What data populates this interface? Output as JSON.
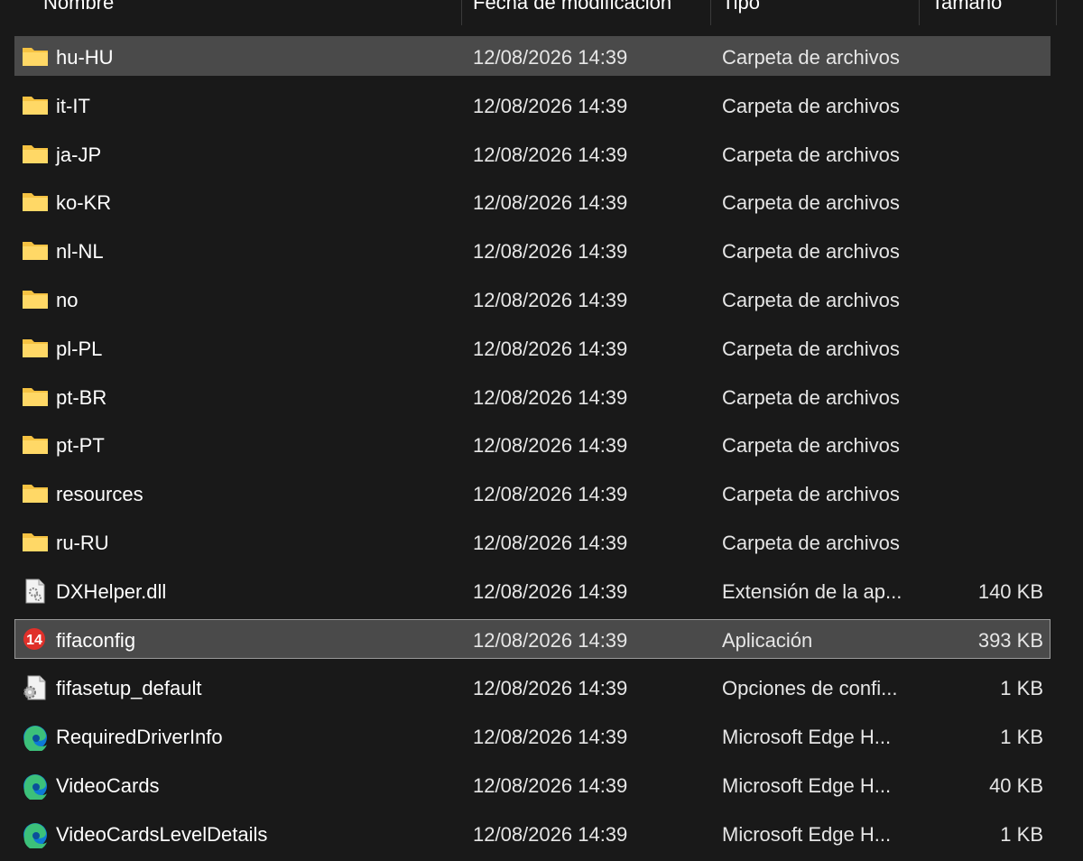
{
  "columns": {
    "name": "Nombre",
    "date": "Fecha de modificación",
    "type": "Tipo",
    "size": "Tamaño"
  },
  "files": [
    {
      "name": "hu-HU",
      "date": "12/08/2026 14:39",
      "type": "Carpeta de archivos",
      "size": "",
      "icon": "folder-icon",
      "state": "selected"
    },
    {
      "name": "it-IT",
      "date": "12/08/2026 14:39",
      "type": "Carpeta de archivos",
      "size": "",
      "icon": "folder-icon",
      "state": ""
    },
    {
      "name": "ja-JP",
      "date": "12/08/2026 14:39",
      "type": "Carpeta de archivos",
      "size": "",
      "icon": "folder-icon",
      "state": ""
    },
    {
      "name": "ko-KR",
      "date": "12/08/2026 14:39",
      "type": "Carpeta de archivos",
      "size": "",
      "icon": "folder-icon",
      "state": ""
    },
    {
      "name": "nl-NL",
      "date": "12/08/2026 14:39",
      "type": "Carpeta de archivos",
      "size": "",
      "icon": "folder-icon",
      "state": ""
    },
    {
      "name": "no",
      "date": "12/08/2026 14:39",
      "type": "Carpeta de archivos",
      "size": "",
      "icon": "folder-icon",
      "state": ""
    },
    {
      "name": "pl-PL",
      "date": "12/08/2026 14:39",
      "type": "Carpeta de archivos",
      "size": "",
      "icon": "folder-icon",
      "state": ""
    },
    {
      "name": "pt-BR",
      "date": "12/08/2026 14:39",
      "type": "Carpeta de archivos",
      "size": "",
      "icon": "folder-icon",
      "state": ""
    },
    {
      "name": "pt-PT",
      "date": "12/08/2026 14:39",
      "type": "Carpeta de archivos",
      "size": "",
      "icon": "folder-icon",
      "state": ""
    },
    {
      "name": "resources",
      "date": "12/08/2026 14:39",
      "type": "Carpeta de archivos",
      "size": "",
      "icon": "folder-icon",
      "state": ""
    },
    {
      "name": "ru-RU",
      "date": "12/08/2026 14:39",
      "type": "Carpeta de archivos",
      "size": "",
      "icon": "folder-icon",
      "state": ""
    },
    {
      "name": "DXHelper.dll",
      "date": "12/08/2026 14:39",
      "type": "Extensión de la ap...",
      "size": "140 KB",
      "icon": "dll-file-icon",
      "state": ""
    },
    {
      "name": "fifaconfig",
      "date": "12/08/2026 14:39",
      "type": "Aplicación",
      "size": "393 KB",
      "icon": "fifa14-app-icon",
      "icon_text": "14",
      "state": "focused"
    },
    {
      "name": "fifasetup_default",
      "date": "12/08/2026 14:39",
      "type": "Opciones de confi...",
      "size": "1 KB",
      "icon": "config-file-icon",
      "state": ""
    },
    {
      "name": "RequiredDriverInfo",
      "date": "12/08/2026 14:39",
      "type": "Microsoft Edge H...",
      "size": "1 KB",
      "icon": "edge-html-icon",
      "state": ""
    },
    {
      "name": "VideoCards",
      "date": "12/08/2026 14:39",
      "type": "Microsoft Edge H...",
      "size": "40 KB",
      "icon": "edge-html-icon",
      "state": ""
    },
    {
      "name": "VideoCardsLevelDetails",
      "date": "12/08/2026 14:39",
      "type": "Microsoft Edge H...",
      "size": "1 KB",
      "icon": "edge-html-icon",
      "state": ""
    }
  ],
  "colors": {
    "background": "#191919",
    "selected_row": "#4a4a4a",
    "focus_border": "#9a9a9a",
    "folder": "#f5c242",
    "fifa_red": "#e0302a",
    "edge_blue": "#0c7ad6",
    "edge_green": "#3cc07a"
  }
}
